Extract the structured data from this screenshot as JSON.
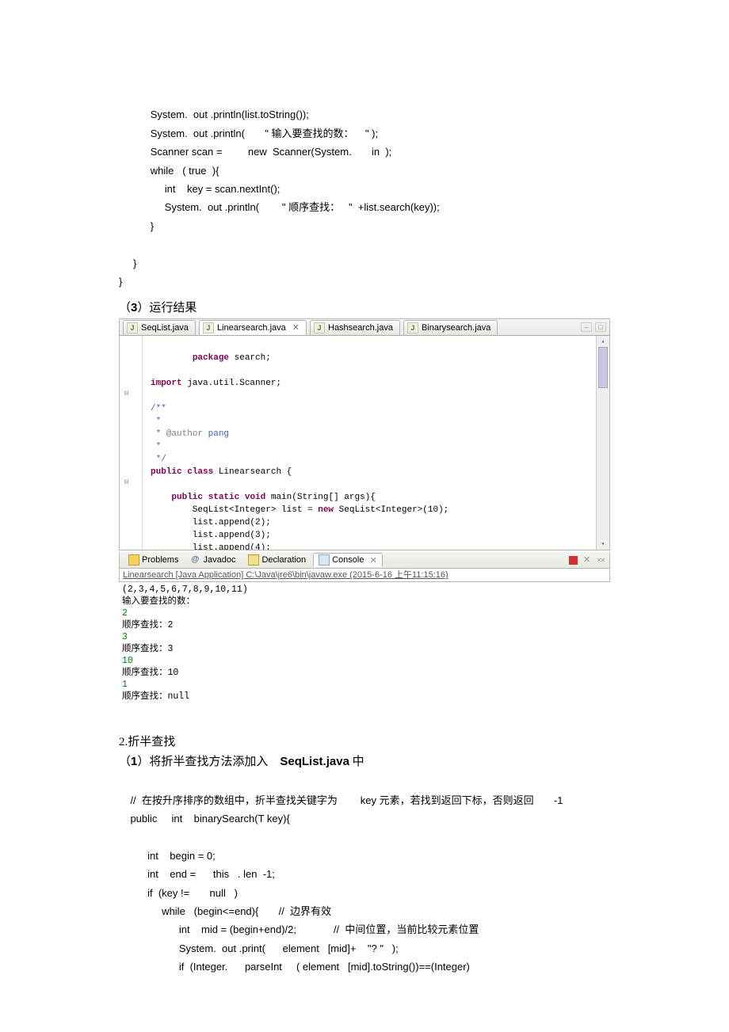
{
  "code_top": {
    "l1": "           System.  out .println(list.toString());",
    "l2": "           System.  out .println(       \" 输入要查找的数：    \" );",
    "l3": "           Scanner scan =         new  Scanner(System.       in  );",
    "l4": "           while   ( true  ){",
    "l5": "                int    key = scan.nextInt();",
    "l6": "                System.  out .println(        \" 顺序查找：   \"  +list.search(key));",
    "l7": "           }",
    "l8": "",
    "l9": "     }",
    "l10": "}"
  },
  "heading3": "（3）运行结果",
  "tabs": {
    "t1": "SeqList.java",
    "t2": "Linearsearch.java",
    "t3": "Hashsearch.java",
    "t4": "Binarysearch.java"
  },
  "editor": {
    "l1": "package search;",
    "l2": "",
    "l3": "import java.util.Scanner;",
    "l4": "",
    "l5": "/**",
    "l6": " * ",
    "l7": " * @author pang",
    "l8": " * ",
    "l9": " */",
    "l10": "public class Linearsearch {",
    "l11": "",
    "l12": "    public static void main(String[] args){",
    "l13": "        SeqList<Integer> list = new SeqList<Integer>(10);",
    "l14": "        list.append(2);",
    "l15": "        list.append(3);",
    "l16": "        list.append(4);"
  },
  "bottom_tabs": {
    "t1": "Problems",
    "t2": "Javadoc",
    "t3": "Declaration",
    "t4": "Console"
  },
  "console_desc": "Linearsearch [Java Application] C:\\Java\\jre6\\bin\\javaw.exe (2015-6-16 上午11:15:16)",
  "console": {
    "l1": "(2,3,4,5,6,7,8,9,10,11)",
    "l2": "输入要查找的数：",
    "l3": "2",
    "l4": "顺序查找：2",
    "l5": "3",
    "l6": "顺序查找：3",
    "l7": "10",
    "l8": "顺序查找：10",
    "l9": "1",
    "l10": "顺序查找：null"
  },
  "section2": "2.折半查找",
  "section2_sub": "（1）将折半查找方法添加入    SeqList.java 中",
  "code_bot": {
    "c1": "    //  在按升序排序的数组中，折半查找关键字为        key 元素，若找到返回下标，否则返回       -1",
    "c2": "    public     int    binarySearch(T key){",
    "c3": "",
    "c4": "          int    begin = 0;",
    "c5": "          int    end =      this   . len  -1;",
    "c6": "          if  (key !=       null   )",
    "c7": "               while   (begin<=end){       //  边界有效",
    "c8": "                     int    mid = (begin+end)/2;             //  中间位置，当前比较元素位置",
    "c9": "                     System.  out .print(      element   [mid]+    \"? \"   );",
    "c10": "                     if  (Integer.      parseInt     ( element   [mid].toString())==(Integer)"
  }
}
